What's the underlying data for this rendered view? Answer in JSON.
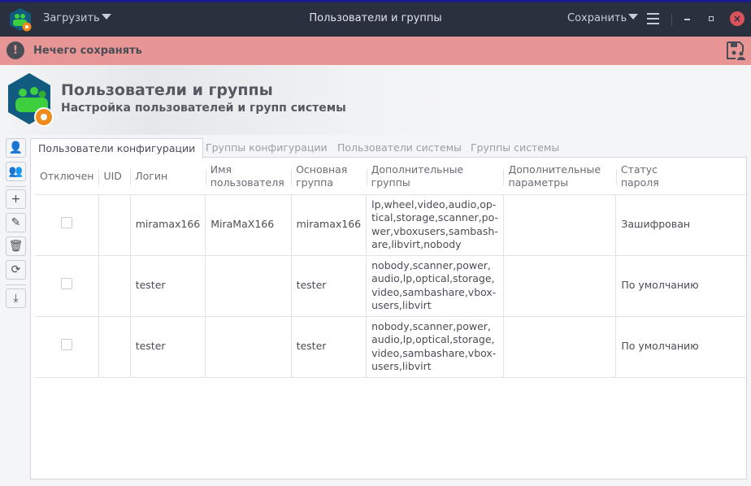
{
  "titlebar": {
    "load_label": "Загрузить",
    "title": "Пользователи и группы",
    "save_label": "Сохранить"
  },
  "banner": {
    "message": "Нечего сохранять"
  },
  "header": {
    "title": "Пользователи и группы",
    "subtitle": "Настройка пользователей и групп системы"
  },
  "tabs": [
    {
      "label": "Пользователи конфигурации",
      "active": true
    },
    {
      "label": "Группы конфигурации"
    },
    {
      "label": "Пользователи системы"
    },
    {
      "label": "Группы системы"
    }
  ],
  "table": {
    "columns": [
      [
        "Отключен"
      ],
      [
        "UID"
      ],
      [
        "Логин"
      ],
      [
        "Имя",
        "пользователя"
      ],
      [
        "Основная",
        "группа"
      ],
      [
        "Дополнительные",
        "группы"
      ],
      [
        "Дополнительные",
        "параметры"
      ],
      [
        "Статус",
        "пароля"
      ]
    ],
    "rows": [
      {
        "disabled": false,
        "uid": "",
        "login": "miramax166",
        "name": "MiraMaX166",
        "group": "miramax166",
        "extra_groups": [
          "lp,wheel,video,audio,op-",
          "tical,storage,scanner,po-",
          "wer,vboxusers,sambash-",
          "are,libvirt,nobody"
        ],
        "params": "",
        "status": "Зашифрован"
      },
      {
        "disabled": false,
        "uid": "",
        "login": "tester",
        "name": "",
        "group": "tester",
        "extra_groups": [
          "nobody,scanner,power,",
          "audio,lp,optical,storage,",
          "video,sambashare,vbox-",
          "users,libvirt"
        ],
        "params": "",
        "status": "По умолчанию"
      },
      {
        "disabled": false,
        "uid": "",
        "login": "tester",
        "name": "",
        "group": "tester",
        "extra_groups": [
          "nobody,scanner,power,",
          "audio,lp,optical,storage,",
          "video,sambashare,vbox-",
          "users,libvirt"
        ],
        "params": "",
        "status": "По умолчанию"
      }
    ]
  },
  "colors": {
    "titlebar": "#2b303f",
    "banner": "#e89595",
    "close": "#d9535a",
    "accent_green": "#3ecf3e",
    "accent_orange": "#f08c1e",
    "logo_bg": "#115a80"
  }
}
